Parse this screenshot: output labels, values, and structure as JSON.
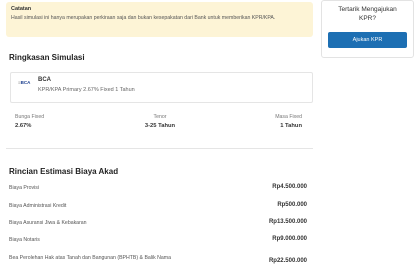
{
  "note": {
    "title": "Catatan",
    "text": "Hasil simulasi ini hanya merupakan perkiraan saja dan bukan kesepakatan dari Bank untuk memberikan KPR/KPA."
  },
  "cta": {
    "title": "Tertarik Mengajukan KPR?",
    "button_label": "Ajukan KPR",
    "button_color": "#1d6fb3"
  },
  "summary": {
    "heading": "Ringkasan Simulasi",
    "bank": {
      "logo_text": "BCA",
      "name": "BCA",
      "product": "KPR/KPA Primary 2.67% Fixed 1 Tahun"
    },
    "metrics": [
      {
        "label": "Bunga Fixed",
        "value": "2.67%"
      },
      {
        "label": "Tenor",
        "value": "3-25 Tahun"
      },
      {
        "label": "Masa Fixed",
        "value": "1 Tahun"
      }
    ]
  },
  "costs": {
    "heading": "Rincian Estimasi Biaya Akad",
    "rows": [
      {
        "label": "Biaya Provisi",
        "amount": "Rp4.500.000"
      },
      {
        "label": "Biaya Administrasi Kredit",
        "amount": "Rp500.000"
      },
      {
        "label": "Biaya Asuransi Jiwa & Kebakaran",
        "amount": "Rp13.500.000"
      },
      {
        "label": "Biaya Notaris",
        "amount": "Rp9.000.000"
      },
      {
        "label": "Bea Perolehan Hak atas Tanah dan Bangunan (BPHTB) & Balik Nama",
        "amount": "Rp22.500.000"
      }
    ]
  }
}
